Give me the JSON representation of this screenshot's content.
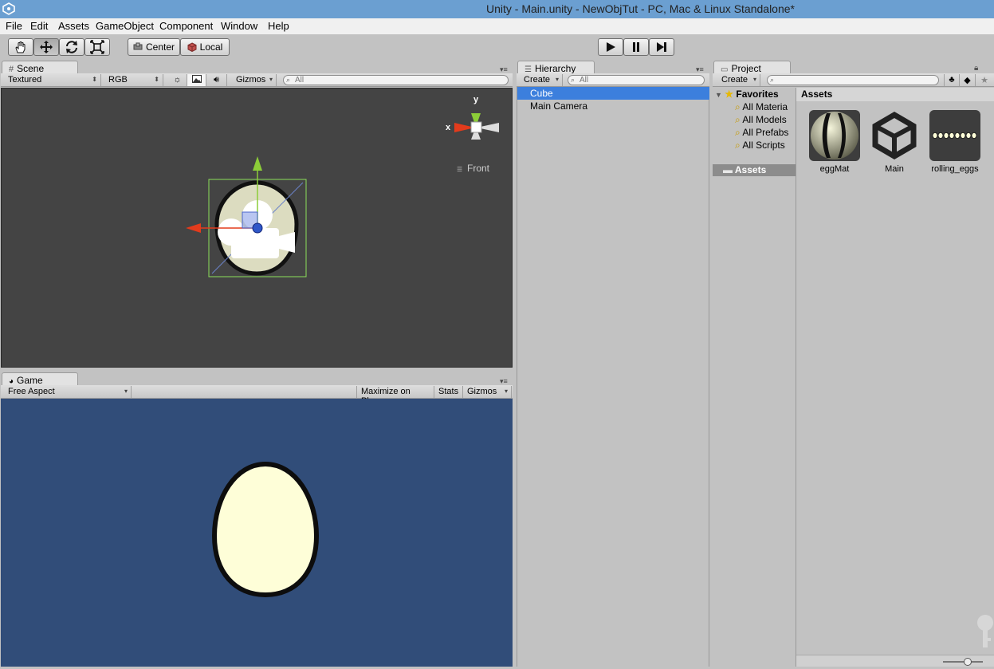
{
  "window": {
    "title": "Unity - Main.unity - NewObjTut - PC, Mac & Linux Standalone*"
  },
  "menu": [
    "File",
    "Edit",
    "Assets",
    "GameObject",
    "Component",
    "Window",
    "Help"
  ],
  "toolbar": {
    "tools": [
      "hand-tool",
      "move-tool",
      "rotate-tool",
      "scale-tool"
    ],
    "active_tool": "move-tool",
    "pivot_label": "Center",
    "space_label": "Local",
    "playback": [
      "play",
      "pause",
      "step"
    ]
  },
  "scene": {
    "tab": "Scene",
    "render_mode": "Textured",
    "color_mode": "RGB",
    "gizmos": "Gizmos",
    "search_placeholder": "All",
    "gizmo_axis_label": "y",
    "gizmo_x_label": "x",
    "view_label": "Front"
  },
  "game": {
    "tab": "Game",
    "aspect": "Free Aspect",
    "maximize": "Maximize on Play",
    "stats": "Stats",
    "gizmos": "Gizmos"
  },
  "hierarchy": {
    "tab": "Hierarchy",
    "create": "Create",
    "search_placeholder": "All",
    "items": [
      {
        "label": "Cube",
        "selected": true
      },
      {
        "label": "Main Camera",
        "selected": false
      }
    ]
  },
  "project": {
    "tab": "Project",
    "create": "Create",
    "favorites_label": "Favorites",
    "favorites": [
      "All Materia",
      "All Models",
      "All Prefabs",
      "All Scripts"
    ],
    "assets_folder": "Assets",
    "assets_header": "Assets",
    "assets": [
      {
        "name": "eggMat",
        "icon": "material-sphere-icon"
      },
      {
        "name": "Main",
        "icon": "unity-scene-icon"
      },
      {
        "name": "rolling_eggs",
        "icon": "prefab-thumbnail-icon"
      }
    ]
  },
  "colors": {
    "selection": "#3c7fdd",
    "scene_bg": "#444444",
    "game_bg": "#314d79",
    "egg_fill": "#fefed8"
  }
}
